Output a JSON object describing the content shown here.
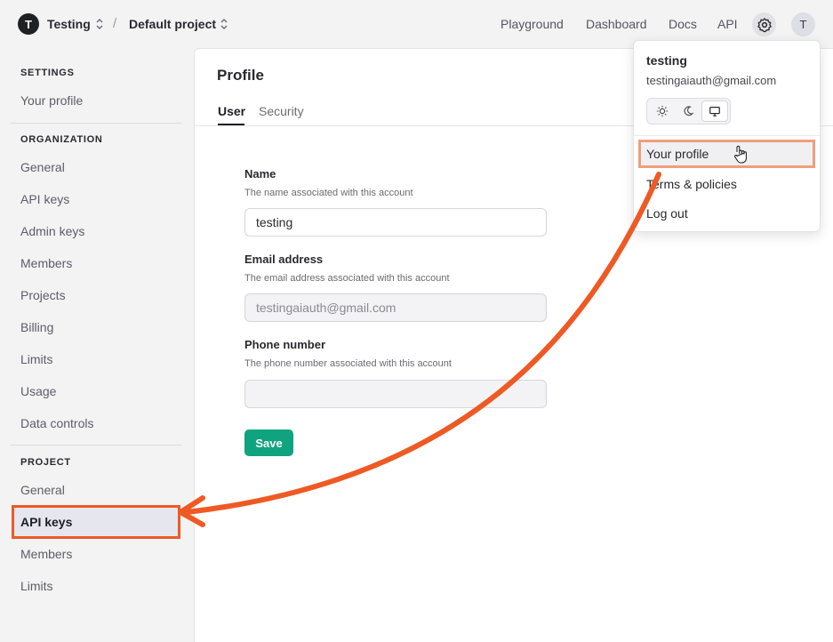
{
  "header": {
    "org_initial": "T",
    "org_name": "Testing",
    "separator": "/",
    "project_name": "Default project",
    "nav": [
      "Playground",
      "Dashboard",
      "Docs",
      "API"
    ],
    "user_initial": "T"
  },
  "sidebar": {
    "settings_label": "SETTINGS",
    "settings_items": [
      "Your profile"
    ],
    "organization_label": "ORGANIZATION",
    "organization_items": [
      "General",
      "API keys",
      "Admin keys",
      "Members",
      "Projects",
      "Billing",
      "Limits",
      "Usage",
      "Data controls"
    ],
    "project_label": "PROJECT",
    "project_items": [
      "General",
      "API keys",
      "Members",
      "Limits"
    ],
    "active_item": "API keys"
  },
  "main": {
    "title": "Profile",
    "tabs": [
      "User",
      "Security"
    ],
    "active_tab": "User",
    "fields": [
      {
        "label": "Name",
        "help": "The name associated with this account",
        "value": "testing"
      },
      {
        "label": "Email address",
        "help": "The email address associated with this account",
        "value": "testingaiauth@gmail.com"
      },
      {
        "label": "Phone number",
        "help": "The phone number associated with this account",
        "value": ""
      }
    ],
    "save_label": "Save"
  },
  "dropdown": {
    "name": "testing",
    "email": "testingaiauth@gmail.com",
    "theme_options": [
      "sun-icon",
      "moon-icon",
      "monitor-icon"
    ],
    "active_theme": "monitor-icon",
    "items": [
      "Your profile",
      "Terms & policies",
      "Log out"
    ]
  },
  "colors": {
    "accent_green": "#10a37f",
    "annotation_orange": "#ee5a24"
  }
}
